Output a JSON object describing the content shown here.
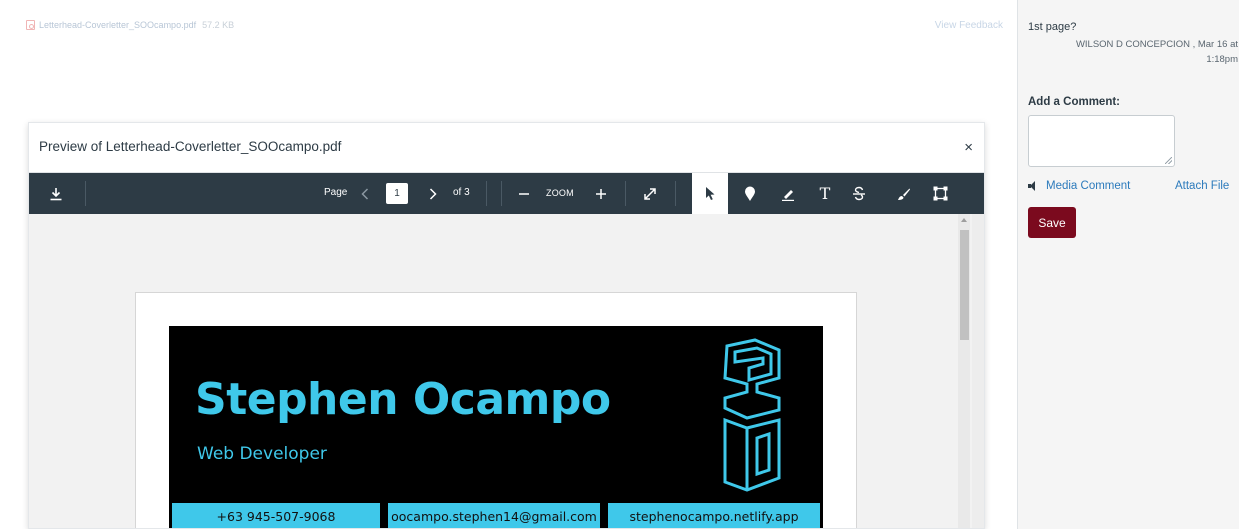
{
  "submission": {
    "file_name": "Letterhead-Coverletter_SOOcampo.pdf",
    "file_size": "57.2 KB",
    "view_feedback": "View Feedback"
  },
  "side_panel": {
    "comment_text": "1st page?",
    "comment_author": "WILSON D CONCEPCION , Mar 16 at",
    "comment_time": "1:18pm",
    "add_comment_label": "Add a Comment:",
    "media_comment": "Media Comment",
    "attach_file": "Attach File",
    "save_label": "Save"
  },
  "modal": {
    "title": "Preview of Letterhead-Coverletter_SOOcampo.pdf",
    "close": "×"
  },
  "toolbar": {
    "page_label": "Page",
    "page_number": "1",
    "of_pages": "of 3",
    "zoom_label": "ZOOM",
    "icons": [
      "download-icon",
      "chevron-left-icon",
      "chevron-right-icon",
      "minus-icon",
      "plus-icon",
      "expand-icon",
      "pointer-icon",
      "pin-icon",
      "highlight-pen-icon",
      "text-icon",
      "strikethrough-icon",
      "brush-icon",
      "area-select-icon"
    ],
    "colors": {
      "toolbar_bg": "#2d3b45",
      "accent": "#3fc8ea",
      "save_bg": "#7b0a1e"
    }
  },
  "document": {
    "name": "Stephen Ocampo",
    "role": "Web Developer",
    "phone": "+63 945-507-9068",
    "email": "oocampo.stephen14@gmail.com",
    "website": "stephenocampo.netlify.app"
  }
}
